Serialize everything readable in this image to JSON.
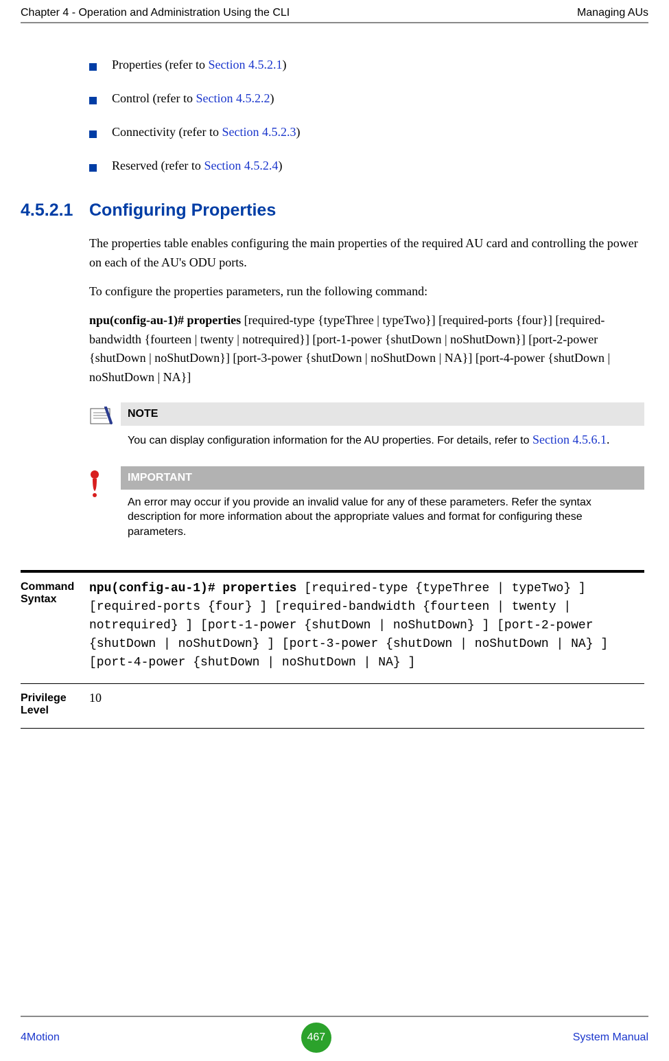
{
  "header": {
    "left": "Chapter 4 - Operation and Administration Using the CLI",
    "right": "Managing AUs"
  },
  "bullets": [
    {
      "prefix": "Properties (refer to ",
      "link": "Section 4.5.2.1",
      "suffix": ")"
    },
    {
      "prefix": "Control (refer to ",
      "link": "Section 4.5.2.2",
      "suffix": ")"
    },
    {
      "prefix": "Connectivity (refer to ",
      "link": "Section 4.5.2.3",
      "suffix": ")"
    },
    {
      "prefix": "Reserved (refer to ",
      "link": "Section 4.5.2.4",
      "suffix": ")"
    }
  ],
  "section": {
    "number": "4.5.2.1",
    "title": "Configuring Properties"
  },
  "paras": {
    "p1": "The properties table enables configuring the main properties of the required AU card and controlling the power on each of the AU's ODU ports.",
    "p2": "To configure the properties parameters, run the following command:",
    "cmd_bold": "npu(config-au-1)# properties ",
    "cmd_rest": "[required-type {typeThree | typeTwo}] [required-ports {four}] [required-bandwidth {fourteen | twenty | notrequired}] [port-1-power {shutDown | noShutDown}] [port-2-power {shutDown | noShutDown}] [port-3-power {shutDown | noShutDown | NA}] [port-4-power {shutDown | noShutDown | NA}]"
  },
  "note": {
    "label": "NOTE",
    "text": "You can display configuration information for the AU properties. For details, refer to ",
    "link": "Section 4.5.6.1",
    "suffix": "."
  },
  "important": {
    "label": "IMPORTANT",
    "text": "An error may occur if you provide an invalid value for any of these parameters. Refer the syntax description for more information about the appropriate values and format for configuring these parameters."
  },
  "table": {
    "row1_label": "Command Syntax",
    "row1_bold": "npu(config-au-1)# properties ",
    "row1_rest": "[required-type {typeThree | typeTwo} ] [required-ports {four} ] [required-bandwidth {fourteen | twenty | notrequired} ] [port-1-power {shutDown | noShutDown} ] [port-2-power {shutDown | noShutDown} ] [port-3-power {shutDown | noShutDown | NA} ] [port-4-power {shutDown | noShutDown | NA} ]",
    "row2_label": "Privilege Level",
    "row2_value": "10"
  },
  "footer": {
    "left": "4Motion",
    "page": "467",
    "right": "System Manual"
  }
}
